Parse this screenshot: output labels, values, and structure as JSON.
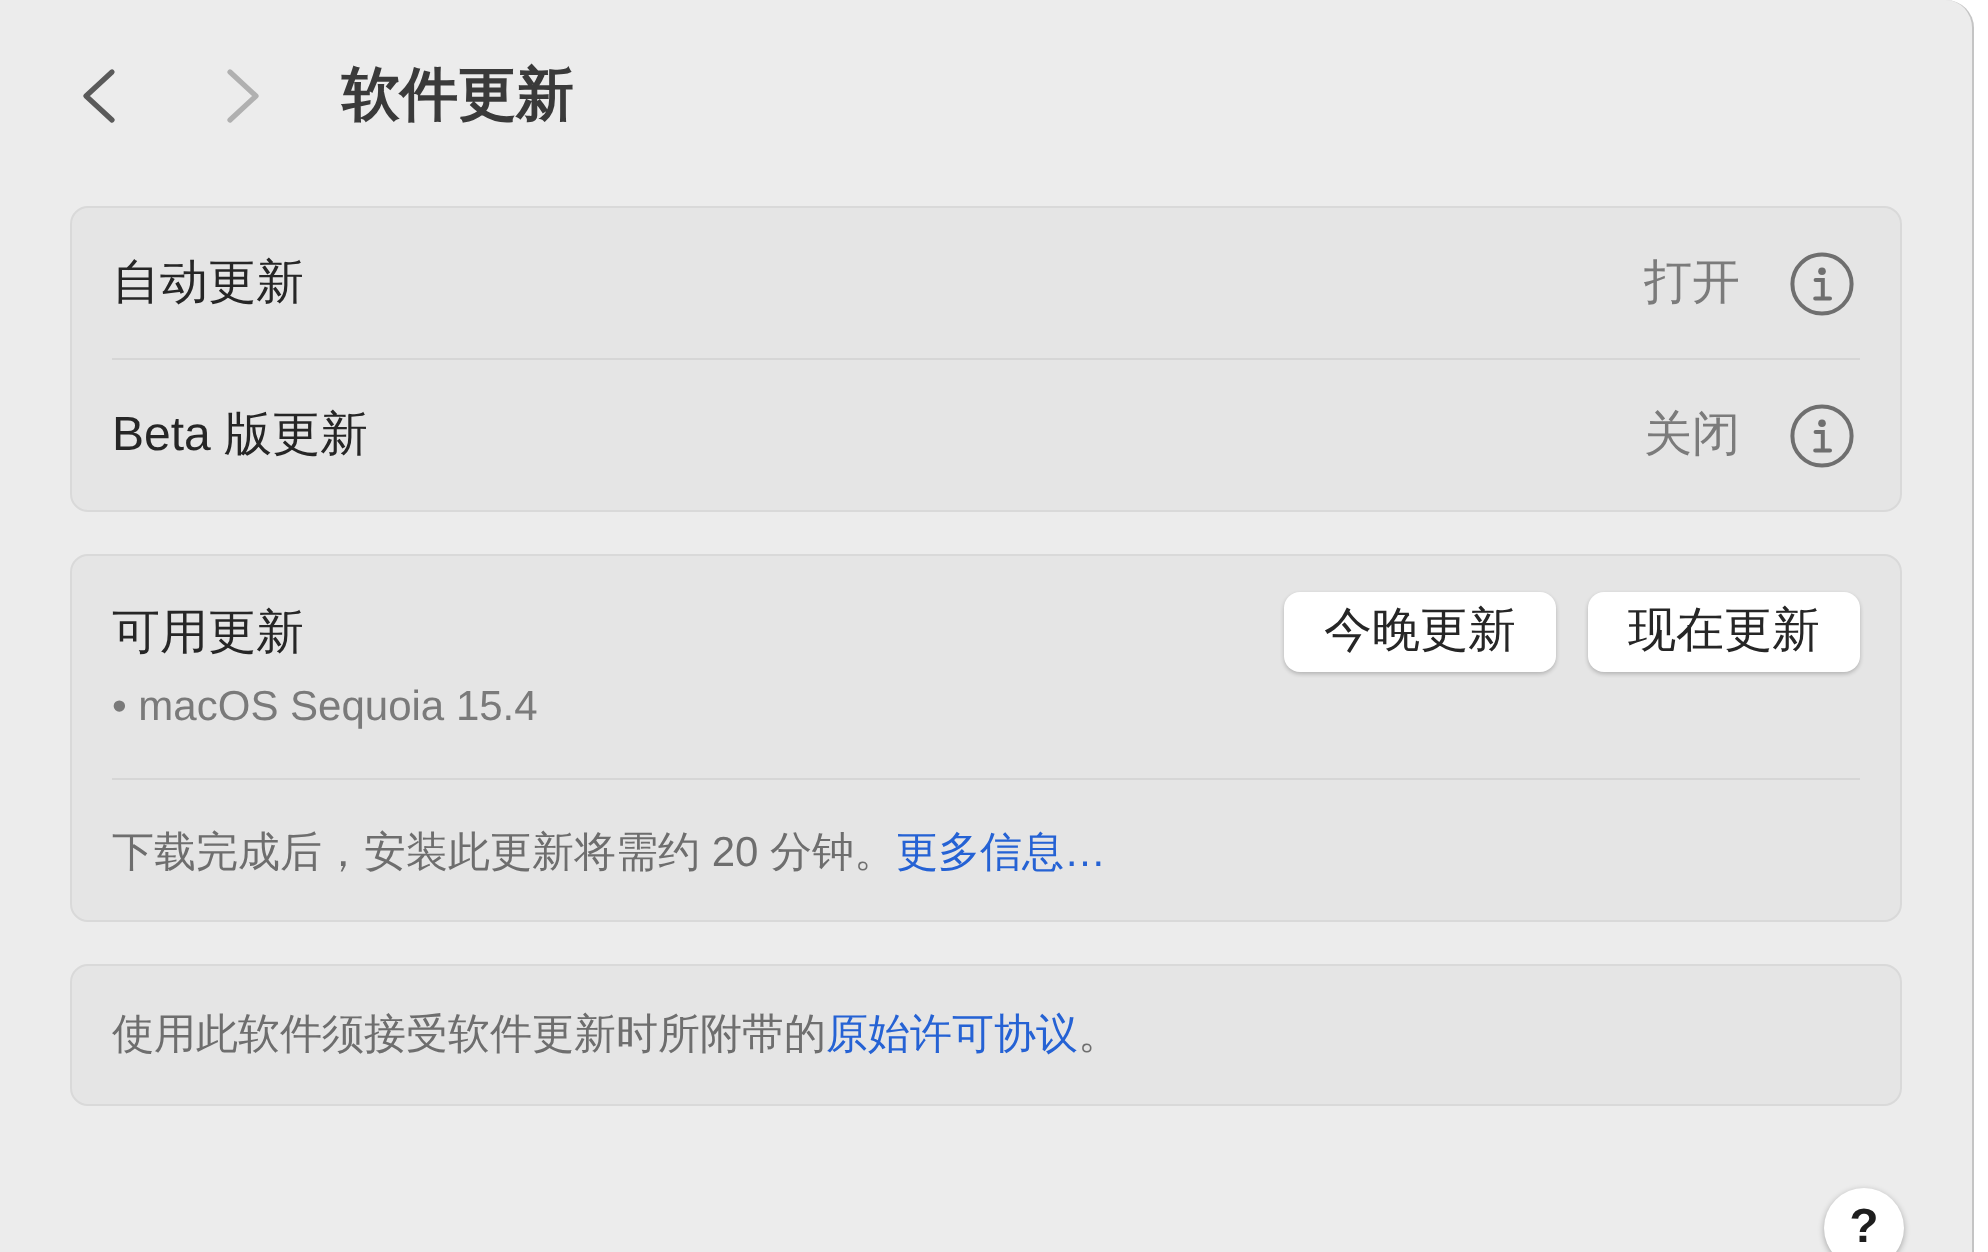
{
  "toolbar": {
    "back": {
      "disabled": false
    },
    "forward": {
      "disabled": true
    },
    "title": "软件更新"
  },
  "settings": [
    {
      "label": "自动更新",
      "value": "打开"
    },
    {
      "label": "Beta 版更新",
      "value": "关闭"
    }
  ],
  "available_updates": {
    "title": "可用更新",
    "buttons": [
      {
        "label": "今晚更新"
      },
      {
        "label": "现在更新"
      }
    ],
    "items": [
      "• macOS Sequoia 15.4"
    ],
    "note": "下载完成后，安装此更新将需约 20 分钟。",
    "note_link": "更多信息…"
  },
  "license": {
    "text": "使用此软件须接受软件更新时所附带的",
    "link": "原始许可协议",
    "suffix": "。"
  },
  "help_button": {
    "label": "?"
  }
}
